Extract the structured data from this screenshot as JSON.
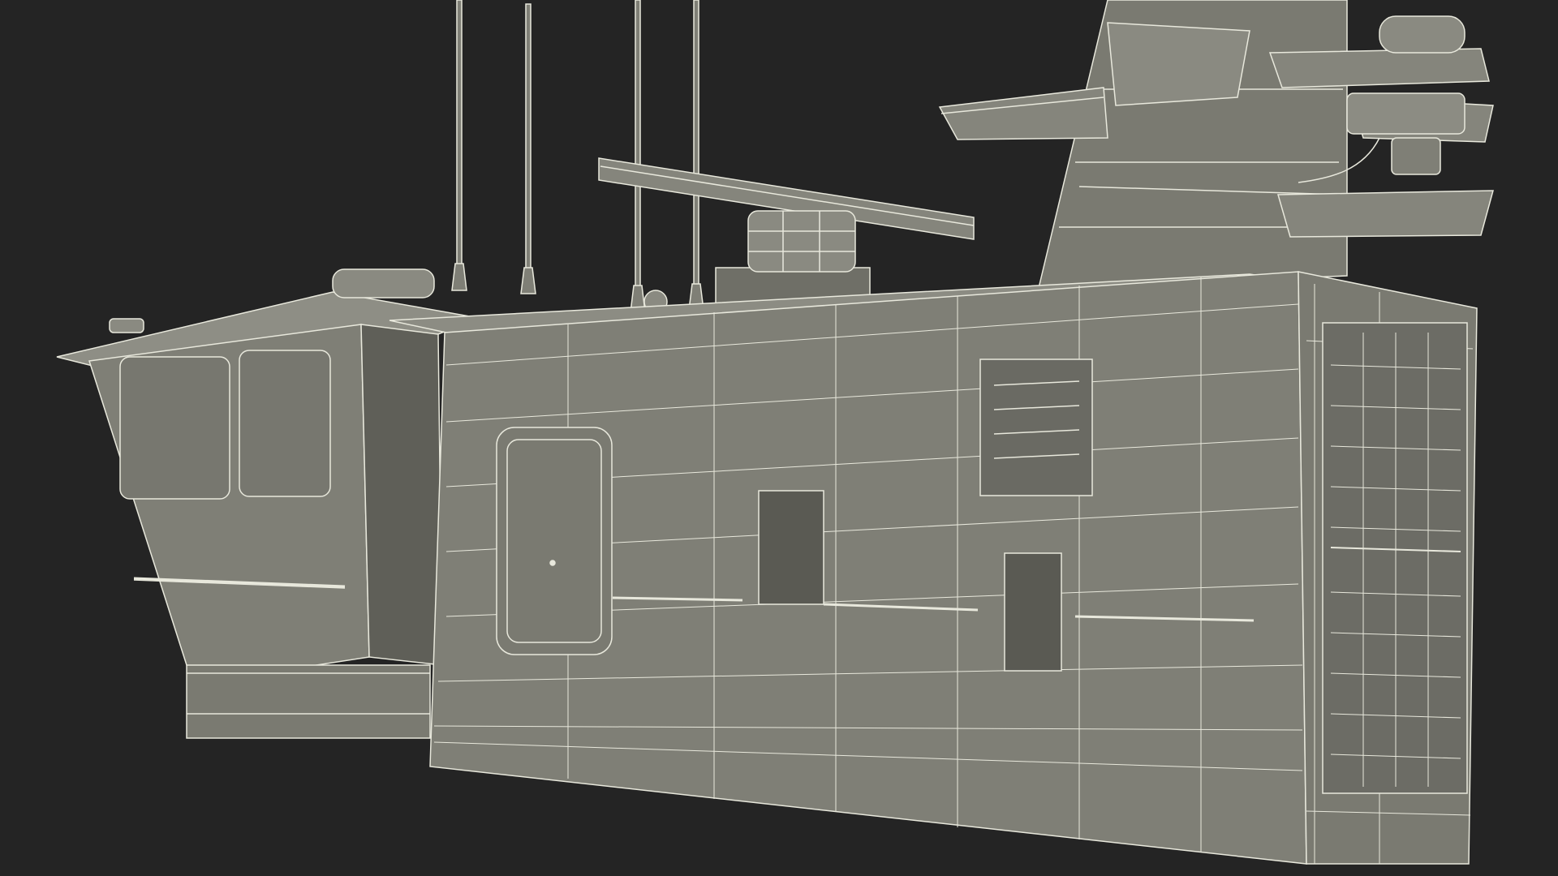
{
  "scene": {
    "background_color": "#242424",
    "surface_color": "#7f7f76",
    "surface_dark_color": "#5f5f58",
    "surface_light_color": "#8c8c83",
    "wire_color": "#e8e8dc",
    "subject": "wireframe-ship-superstructure"
  }
}
